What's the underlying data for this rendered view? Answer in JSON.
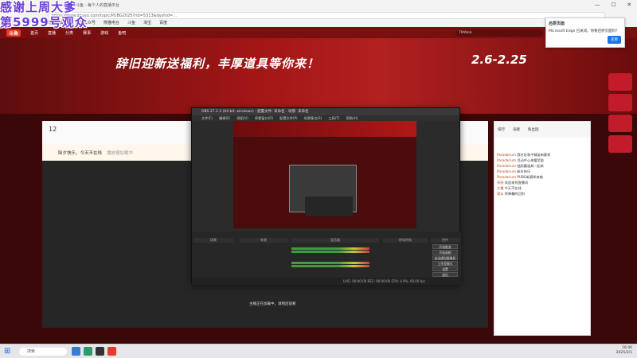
{
  "overlay": {
    "line1": "感谢上周大爹",
    "line2": "第5999号观众"
  },
  "browser": {
    "tab_title": "斗鱼 - 每个人的直播平台",
    "address": "https://www.douyu.com/topic/PUBG2025?rid=5313&dyshid=...",
    "favorites": [
      "导入收藏夹",
      "腾讯公众号",
      "熊猫电台",
      "斗鱼",
      "淘宝",
      "百度"
    ],
    "window_buttons": [
      "—",
      "☐",
      "✕"
    ]
  },
  "edge_popup": {
    "title": "还原页面",
    "body": "Microsoft Edge 已关闭。你要还原页面吗？",
    "button": "还原"
  },
  "site": {
    "logo": "斗鱼",
    "nav": [
      "首页",
      "直播",
      "分类",
      "赛事",
      "游戏",
      "鱼吧"
    ],
    "search_placeholder": "TMWeb",
    "slogan": "辞旧迎新送福利，丰厚道具等你来！",
    "dates": "2.6-2.25",
    "room_title": "除夕快乐，今天不在线",
    "room_subtitle": "播放器加载中",
    "header_count": "12",
    "caption": "主播正在加载中，请稍后观看",
    "chat_tabs": [
      "排行",
      "贡献",
      "粉丝团"
    ],
    "chat_lines": [
      {
        "user": "Paradarium",
        "text": "我在玩和平精英新赛季"
      },
      {
        "user": "Paradarium",
        "text": "活动中心海量奖励"
      },
      {
        "user": "Paradarium",
        "text": "抽奖赢道具一起来"
      },
      {
        "user": "Paradarium",
        "text": "新年快乐"
      },
      {
        "user": "Paradarium",
        "text": "PUBG新赛季来临"
      },
      {
        "user": "系统",
        "text": "欢迎来到直播间"
      },
      {
        "user": "主播",
        "text": "今天不在线"
      },
      {
        "user": "观众",
        "text": "将弹幕的回到"
      }
    ]
  },
  "obs": {
    "title": "OBS 27.1.3 (64-bit, windows) - 配置文件: 未命名 - 场景: 未命名",
    "menu": [
      "文件(F)",
      "编辑(E)",
      "视图(V)",
      "停靠窗口(D)",
      "配置文件(P)",
      "场景集合(S)",
      "工具(T)",
      "帮助(H)"
    ],
    "docks": [
      "场景",
      "来源",
      "混音器",
      "转场特效",
      "控件"
    ],
    "controls": [
      "开始推流",
      "开始录制",
      "启动虚拟摄像机",
      "工作室模式",
      "设置",
      "退出"
    ],
    "status": "LIVE: 00:00:00  REC: 00:00:00  CPU: 4.9%, 60.00 fps"
  },
  "taskbar": {
    "search": "搜索",
    "time": "18:46",
    "date": "2025/2/1"
  }
}
